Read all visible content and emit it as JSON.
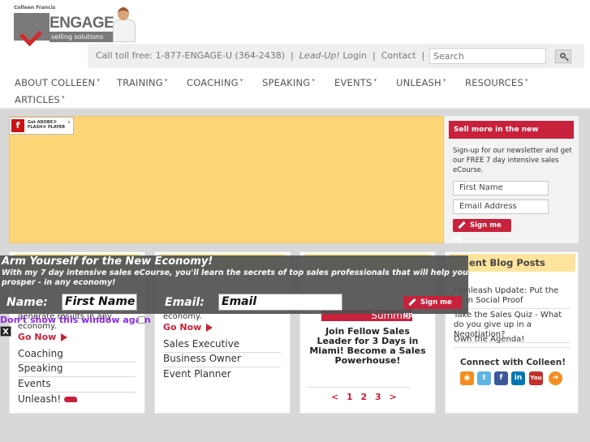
{
  "header": {
    "logo_small": "Colleen Francis",
    "logo_word": "ENGAGE",
    "logo_tag": "selling solutions",
    "toll_free": "Call toll free: 1-877-ENGAGE-U (364-2438)",
    "leadup": "Lead-Up!",
    "login": "Login",
    "contact": "Contact",
    "search_placeholder": "Search",
    "sep": "|"
  },
  "nav": {
    "items": [
      "ABOUT COLLEEN",
      "TRAINING",
      "COACHING",
      "SPEAKING",
      "EVENTS",
      "UNLEASH",
      "RESOURCES",
      "ARTICLES"
    ],
    "caret": "▾"
  },
  "flash": {
    "badge_letter": "f",
    "badge_line1": "Get ADOBE®",
    "badge_line2": "FLASH® PLAYER",
    "badge_download": "⇣"
  },
  "signup": {
    "banner": "Sell more in the new economy!",
    "text": "Sign-up for our newsletter and get our FREE 7 day intensive sales eCourse.",
    "first_name": "First Name",
    "email": "Email Address",
    "button": "Sign me up"
  },
  "card1": {
    "partial": "generate results in any economy.",
    "go_now": "Go Now",
    "links": [
      "Coaching",
      "Speaking",
      "Events",
      "Unleash!"
    ]
  },
  "card2": {
    "partial": "economy.",
    "go_now": "Go Now",
    "links": [
      "Sales Executive",
      "Business Owner",
      "Event Planner"
    ]
  },
  "card3": {
    "summit": "Summit",
    "text": "Join Fellow Sales Leader for 3 Days in Miami! Become a Sales Powerhouse!",
    "pager": "< 1 2 3 >"
  },
  "card4": {
    "title": "ent Blog Posts",
    "posts": [
      "r Unleash Update: Put the ial in Social Proof",
      "Take the Sales Quiz - What do you give up in a Negotiation?",
      "Own the Agenda!"
    ],
    "connect": "Connect with Colleen!",
    "social": [
      "rss-icon",
      "twitter-icon",
      "facebook-icon",
      "linkedin-icon",
      "youtube-icon",
      "next-arrow-icon"
    ]
  },
  "overlay": {
    "title": "Arm Yourself for the New Economy!",
    "subtitle": "With my 7 day intensive sales eCourse, you'll learn the secrets of top sales professionals that will help you prosper - in any economy!",
    "name_label": "Name:",
    "name_value": "First Name",
    "email_label": "Email:",
    "email_value": "Email",
    "button": "Sign me up",
    "dont_show": "Don't show this window again",
    "close": "X"
  }
}
